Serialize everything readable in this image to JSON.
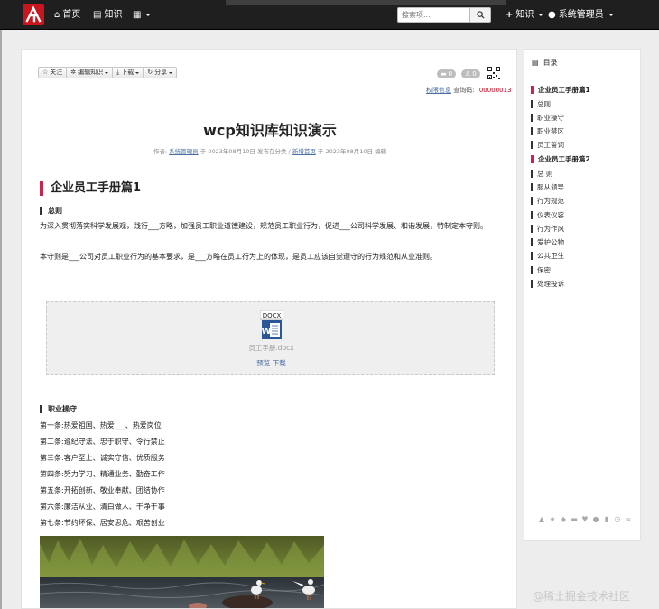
{
  "nav": {
    "home": "首页",
    "knowledge": "知识",
    "knowledge_menu": "知识",
    "admin": "系统管理员",
    "search_placeholder": "搜索项..."
  },
  "toolbar": {
    "follow": "关注",
    "edit": "编辑知识",
    "download": "下载",
    "share": "分享"
  },
  "badges": {
    "comments": "0",
    "likes": "0"
  },
  "meta": {
    "permission_link": "权限信息",
    "query_code_label": "查询码:",
    "query_code": "00000013"
  },
  "doc": {
    "title": "wcp知识库知识演示",
    "author_label": "作者:",
    "author": "系统管理员",
    "created": "于 2023年08月10日 发布在分类 /",
    "category": "新增首页",
    "updated": "于 2023年08月10日 编辑"
  },
  "section1": {
    "heading": "企业员工手册篇1",
    "sub1": "总则",
    "para1": "为深入贯彻落实科学发展观，践行___方略，加强员工职业道德建设，规范员工职业行为，促进___公司科学发展、和谐发展，特制定本守则。",
    "para2": "本守则是___公司对员工职业行为的基本要求，是___方略在员工行为上的体现，是员工应该自觉遵守的行为规范和从业准则。"
  },
  "attachment": {
    "icon_text": "DOCX",
    "file_name": "员工手册.docx",
    "preview": "预览",
    "download": "下载"
  },
  "section2": {
    "sub": "职业操守",
    "rules": [
      "第一条:热爱祖国、热爱___、热爱岗位",
      "第二条:遵纪守法、忠于职守、令行禁止",
      "第三条:客户至上、诚实守信、优质服务",
      "第四条:努力学习、精通业务、勤奋工作",
      "第五条:开拓创新、敬业奉献、团结协作",
      "第六条:廉洁从业、清白做人、干净干事",
      "第七条:节约环保、居安思危、艰苦创业"
    ]
  },
  "toc": {
    "title": "目录",
    "items": [
      {
        "label": "企业员工手册篇1",
        "level": 1
      },
      {
        "label": "总则",
        "level": 2
      },
      {
        "label": "职业操守",
        "level": 2
      },
      {
        "label": "职业禁区",
        "level": 2
      },
      {
        "label": "员工誓词",
        "level": 2
      },
      {
        "label": "企业员工手册篇2",
        "level": 1
      },
      {
        "label": "总 则",
        "level": 2
      },
      {
        "label": "服从领导",
        "level": 2
      },
      {
        "label": "行为规范",
        "level": 2
      },
      {
        "label": "仪表仪容",
        "level": 2
      },
      {
        "label": "行为作风",
        "level": 2
      },
      {
        "label": "爱护公物",
        "level": 2
      },
      {
        "label": "公共卫生",
        "level": 2
      },
      {
        "label": "保密",
        "level": 2
      },
      {
        "label": "处理投诉",
        "level": 2
      }
    ]
  },
  "watermark": "@稀土掘金技术社区",
  "colors": {
    "accent": "#c7254e",
    "brand": "#c9151e",
    "link": "#4a6fa5",
    "navbar": "#1f1f1f"
  }
}
